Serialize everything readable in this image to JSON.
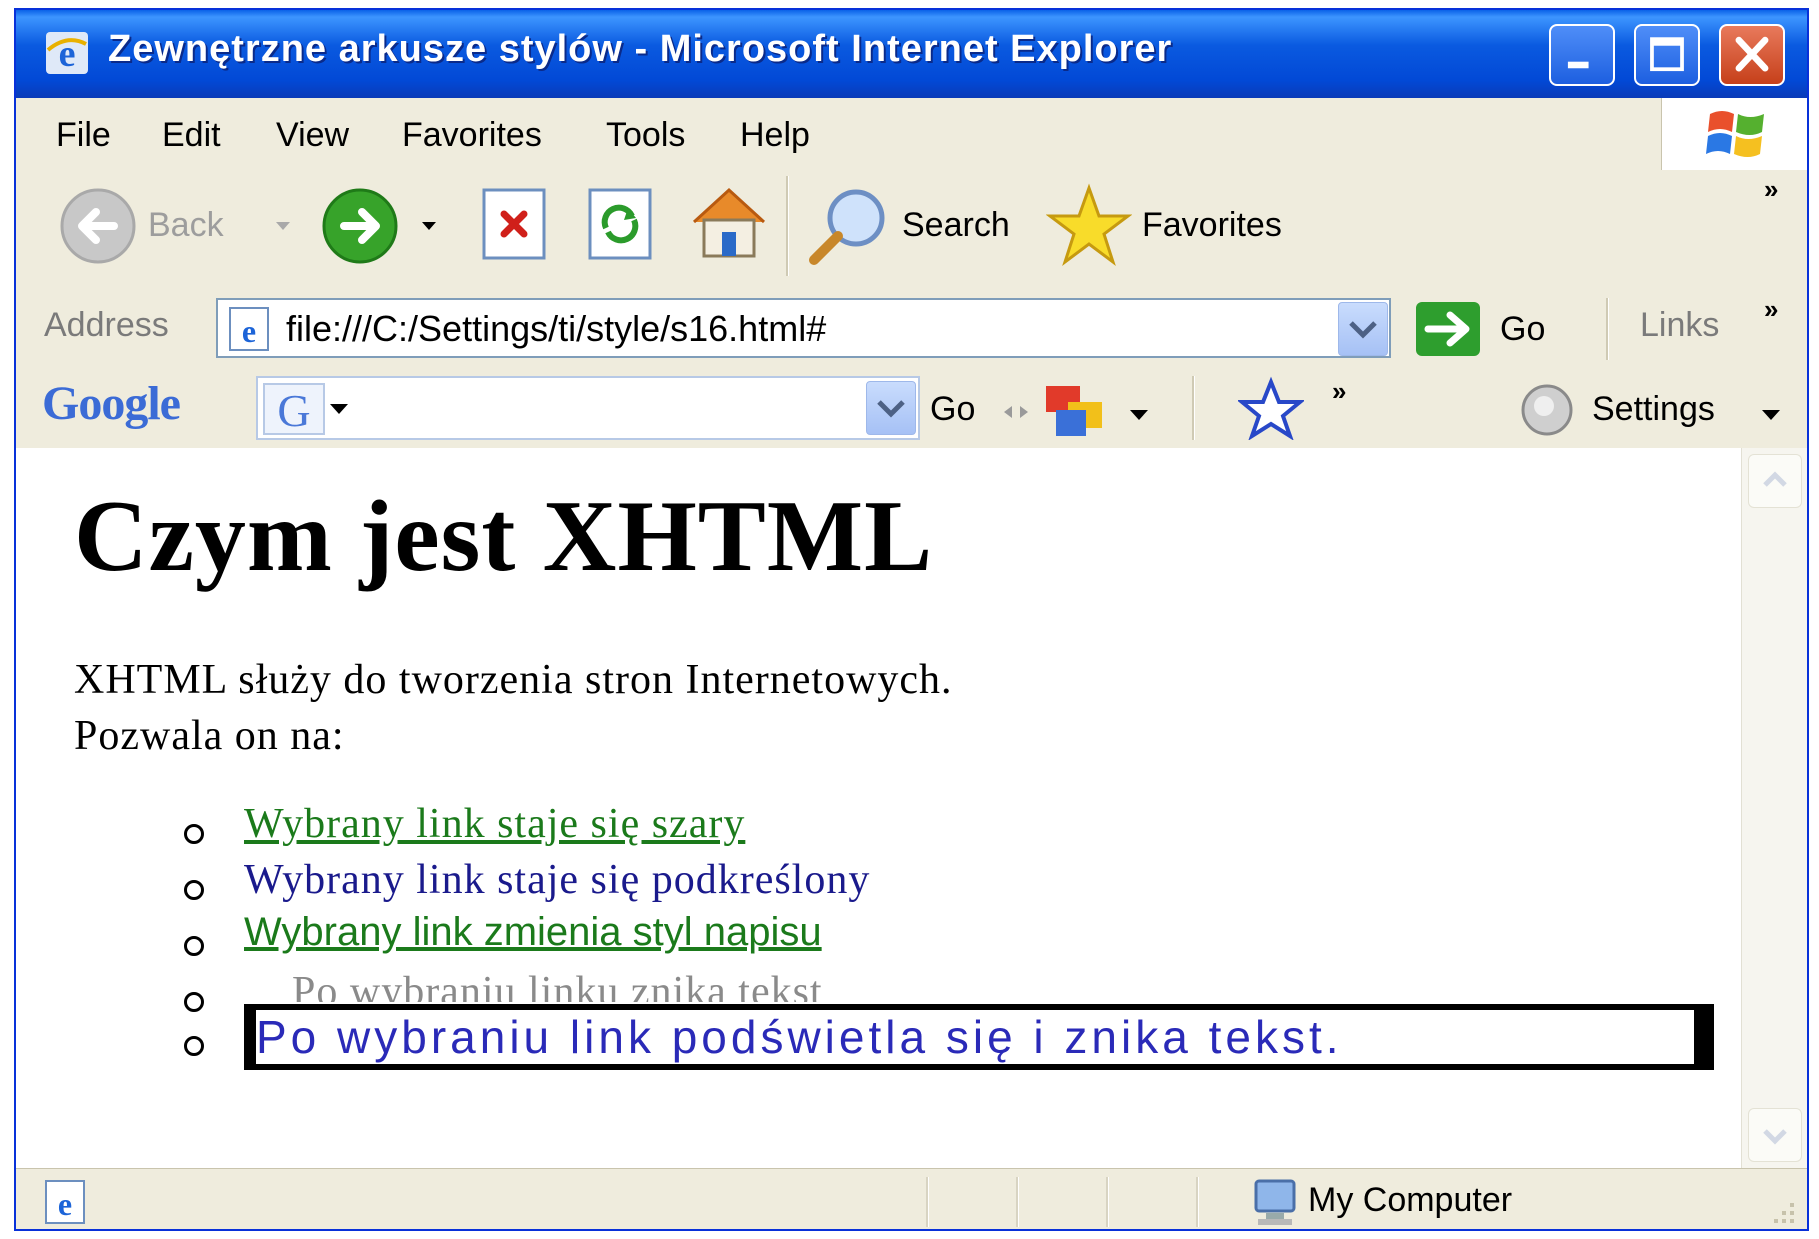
{
  "window": {
    "title": "Zewnętrzne arkusze stylów - Microsoft Internet Explorer"
  },
  "menu": [
    {
      "label": "File"
    },
    {
      "label": "Edit"
    },
    {
      "label": "View"
    },
    {
      "label": "Favorites"
    },
    {
      "label": "Tools"
    },
    {
      "label": "Help"
    }
  ],
  "toolbar": {
    "back_label": "Back",
    "search_label": "Search",
    "favorites_label": "Favorites"
  },
  "address": {
    "label": "Address",
    "url": "file:///C:/Settings/ti/style/s16.html#",
    "go_label": "Go",
    "links_label": "Links"
  },
  "googlebar": {
    "logo_text": "Google",
    "go_label": "Go",
    "settings_label": "Settings"
  },
  "page": {
    "heading": "Czym jest XHTML",
    "intro_line1": "XHTML służy do tworzenia stron Internetowych.",
    "intro_line2": "Pozwala on na:",
    "links": [
      {
        "text": "Wybrany link staje się szary"
      },
      {
        "text": "Wybrany link staje się podkreślony"
      },
      {
        "text": "Wybrany link zmienia styl napisu"
      },
      {
        "text": "Po wybraniu linku znika tekst"
      },
      {
        "text": "Po wybraniu link podświetla się i znika tekst."
      }
    ]
  },
  "status": {
    "zone_label": "My Computer"
  },
  "colors": {
    "titlebar": "#0a5ae0",
    "link_green": "#1b7a1b",
    "link_navy": "#1a1a8c",
    "link_gray": "#8a8a8a",
    "link_blue": "#2a2ab8"
  }
}
